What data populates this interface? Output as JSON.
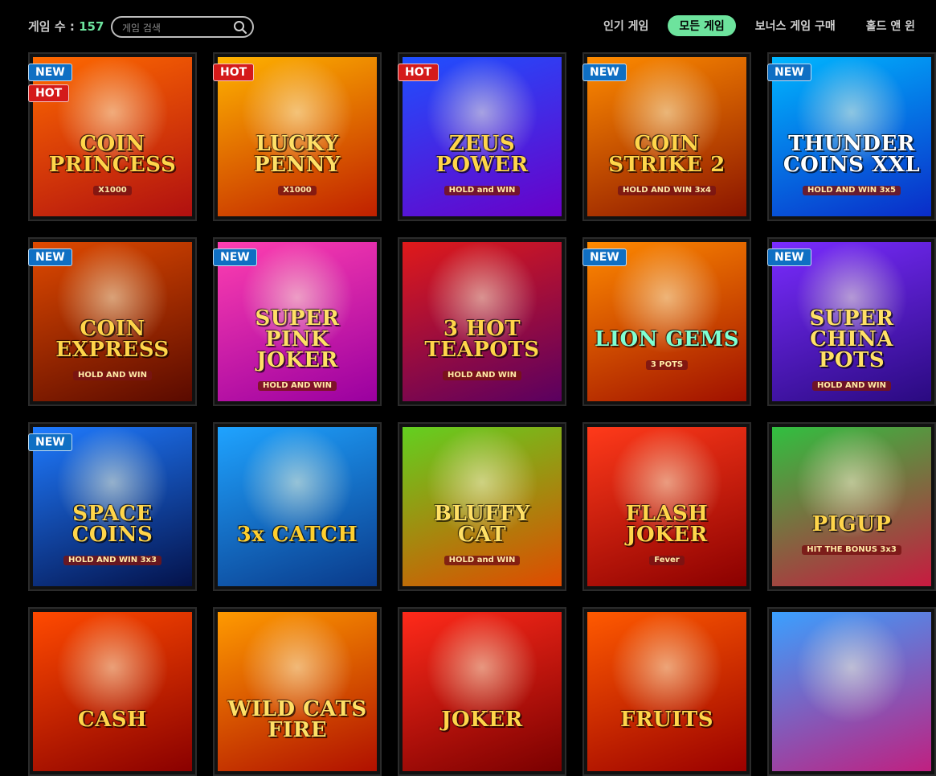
{
  "header": {
    "count_label": "게임 수 : ",
    "count_value": "157",
    "search_placeholder": "게임 검색",
    "tabs": [
      {
        "label": "인기 게임",
        "active": false
      },
      {
        "label": "모든 게임",
        "active": true
      },
      {
        "label": "보너스 게임 구매",
        "active": false
      },
      {
        "label": "홀드 앤 윈",
        "active": false
      }
    ]
  },
  "colors": {
    "accent": "#6de39d",
    "badge_new": "#0f6fc3",
    "badge_hot": "#d41a1a"
  },
  "games": [
    {
      "title": "COIN PRINCESS",
      "sub": "X1000",
      "badges": [
        "NEW",
        "HOT"
      ],
      "bg": [
        "#ff6a00",
        "#b01010"
      ],
      "fg": "#ffd54a"
    },
    {
      "title": "LUCKY PENNY",
      "sub": "X1000",
      "badges": [
        "HOT"
      ],
      "bg": [
        "#ffb300",
        "#c02000"
      ],
      "fg": "#ffe066"
    },
    {
      "title": "ZEUS POWER",
      "sub": "HOLD and WIN",
      "badges": [
        "HOT"
      ],
      "bg": [
        "#1e50ff",
        "#6a00c8"
      ],
      "fg": "#ffd54a"
    },
    {
      "title": "COIN STRIKE 2",
      "sub": "HOLD AND WIN 3x4",
      "badges": [
        "NEW"
      ],
      "bg": [
        "#ff8c00",
        "#8a1400"
      ],
      "fg": "#ffd54a"
    },
    {
      "title": "THUNDER COINS XXL",
      "sub": "HOLD AND WIN 3x5",
      "badges": [
        "NEW"
      ],
      "bg": [
        "#00b7ff",
        "#0a2cc8"
      ],
      "fg": "#ffffff"
    },
    {
      "title": "COIN EXPRESS",
      "sub": "HOLD AND WIN",
      "badges": [
        "NEW"
      ],
      "bg": [
        "#e04a00",
        "#5a0a00"
      ],
      "fg": "#ffd54a"
    },
    {
      "title": "SUPER PINK JOKER",
      "sub": "HOLD AND WIN",
      "badges": [
        "NEW"
      ],
      "bg": [
        "#ff3fb0",
        "#9a00a0"
      ],
      "fg": "#ffe066"
    },
    {
      "title": "3 HOT TEAPOTS",
      "sub": "HOLD AND WIN",
      "badges": [],
      "bg": [
        "#e01a1a",
        "#5a0060"
      ],
      "fg": "#ffd54a"
    },
    {
      "title": "LION GEMS",
      "sub": "3 POTS",
      "badges": [
        "NEW"
      ],
      "bg": [
        "#ff8a00",
        "#a01000"
      ],
      "fg": "#7fffd2"
    },
    {
      "title": "SUPER CHINA POTS",
      "sub": "HOLD AND WIN",
      "badges": [
        "NEW"
      ],
      "bg": [
        "#7a2cff",
        "#2a0a80"
      ],
      "fg": "#ffe066"
    },
    {
      "title": "SPACE COINS",
      "sub": "HOLD AND WIN 3x3",
      "badges": [
        "NEW"
      ],
      "bg": [
        "#1f7bff",
        "#04124a"
      ],
      "fg": "#ffd54a"
    },
    {
      "title": "3x CATCH",
      "sub": "",
      "badges": [],
      "bg": [
        "#1fa3ff",
        "#0a3a8a"
      ],
      "fg": "#ffcf2e"
    },
    {
      "title": "BLUFFY CAT",
      "sub": "HOLD and WIN",
      "badges": [],
      "bg": [
        "#62d020",
        "#e04a00"
      ],
      "fg": "#ffe066"
    },
    {
      "title": "FLASH JOKER",
      "sub": "Fever",
      "badges": [],
      "bg": [
        "#ff3a1a",
        "#8a0000"
      ],
      "fg": "#ffd54a"
    },
    {
      "title": "PIGUP",
      "sub": "HIT THE BONUS 3x3",
      "badges": [],
      "bg": [
        "#30c040",
        "#c81a40"
      ],
      "fg": "#ffd54a"
    },
    {
      "title": "CASH",
      "sub": "",
      "badges": [],
      "bg": [
        "#ff4a00",
        "#8a0000"
      ],
      "fg": "#ffd54a"
    },
    {
      "title": "WILD CATS FIRE",
      "sub": "",
      "badges": [],
      "bg": [
        "#ff9a00",
        "#b01000"
      ],
      "fg": "#ffe066"
    },
    {
      "title": "JOKER",
      "sub": "",
      "badges": [],
      "bg": [
        "#ff2a1a",
        "#7a0000"
      ],
      "fg": "#ffd54a"
    },
    {
      "title": "FRUITS",
      "sub": "",
      "badges": [],
      "bg": [
        "#ff5a00",
        "#9a0000"
      ],
      "fg": "#ffd54a"
    },
    {
      "title": "",
      "sub": "",
      "badges": [],
      "bg": [
        "#3aa0ff",
        "#c02080"
      ],
      "fg": "#ffffff"
    }
  ]
}
